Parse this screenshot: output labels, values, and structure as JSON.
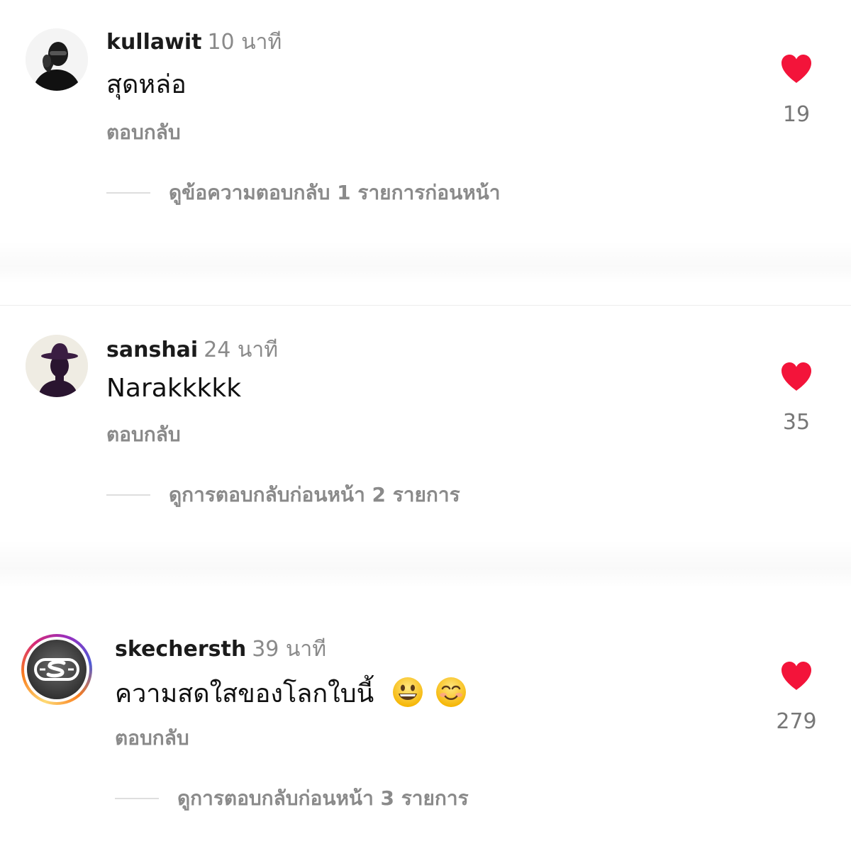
{
  "accent": {
    "like_red": "#f3143a",
    "muted_text": "#8a8a8a",
    "ring_gradient": [
      "#feda75",
      "#fa7e1e",
      "#d62976",
      "#962fbf",
      "#4f5bd5"
    ]
  },
  "comments": [
    {
      "username": "kullawit",
      "time": "10 นาที",
      "text": "สุดหล่อ",
      "reply_label": "ตอบกลับ",
      "likes": "19",
      "view_replies": "ดูข้อความตอบกลับ 1 รายการก่อนหน้า",
      "avatar_icon": "person-portrait-icon"
    },
    {
      "username": "sanshai",
      "time": "24 นาที",
      "text": "Narakkkkk",
      "reply_label": "ตอบกลับ",
      "likes": "35",
      "view_replies": "ดูการตอบกลับก่อนหน้า 2 รายการ",
      "avatar_icon": "hat-silhouette-icon"
    },
    {
      "username": "skechersth",
      "time": "39 นาที",
      "text": "ความสดใสของโลกใบนี้",
      "emojis": [
        "grinning-face-emoji",
        "smiling-face-emoji"
      ],
      "reply_label": "ตอบกลับ",
      "likes": "279",
      "view_replies": "ดูการตอบกลับก่อนหน้า 3 รายการ",
      "avatar_icon": "skechers-logo-icon",
      "has_story_ring": true
    }
  ]
}
